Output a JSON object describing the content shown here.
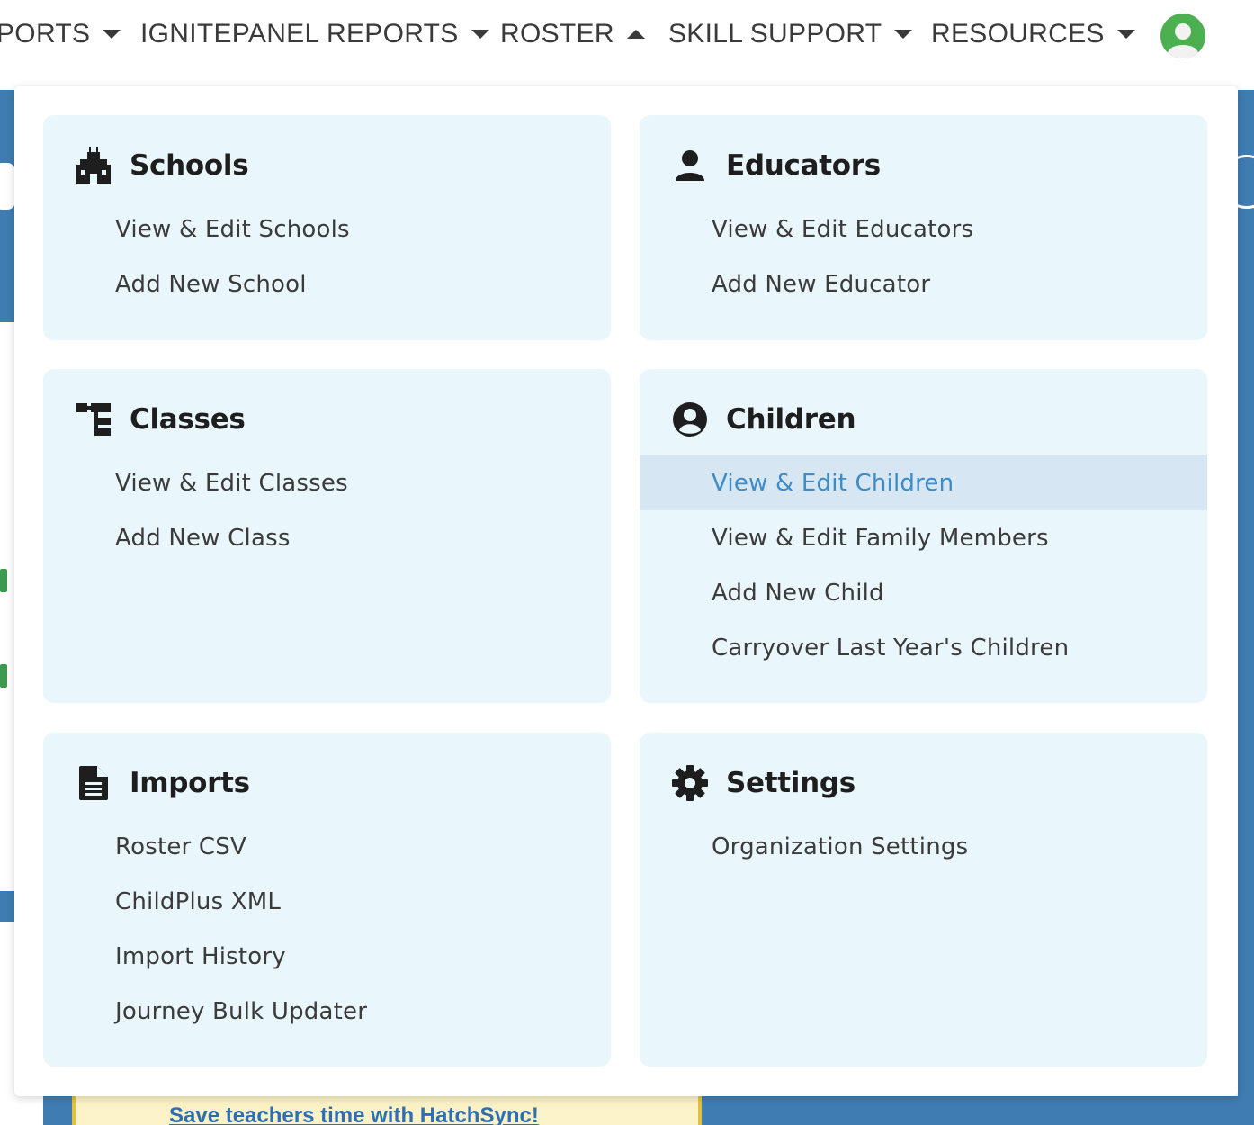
{
  "nav": {
    "items": [
      {
        "label": "PORTS",
        "caret": "down"
      },
      {
        "label": "IGNITEPANEL REPORTS",
        "caret": "down"
      },
      {
        "label": "ROSTER",
        "caret": "up"
      },
      {
        "label": "SKILL SUPPORT",
        "caret": "down"
      },
      {
        "label": "RESOURCES",
        "caret": "down"
      }
    ],
    "avatar_icon": "user-avatar-icon"
  },
  "dropdown": {
    "schools": {
      "title": "Schools",
      "icon": "school-building-icon",
      "links": [
        "View & Edit Schools",
        "Add New School"
      ]
    },
    "educators": {
      "title": "Educators",
      "icon": "person-icon",
      "links": [
        "View & Edit Educators",
        "Add New Educator"
      ]
    },
    "classes": {
      "title": "Classes",
      "icon": "hierarchy-icon",
      "links": [
        "View & Edit Classes",
        "Add New Class"
      ]
    },
    "children": {
      "title": "Children",
      "icon": "user-circle-icon",
      "links": [
        "View & Edit Children",
        "View & Edit Family Members",
        "Add New Child",
        "Carryover Last Year's Children"
      ],
      "active_link": "View & Edit Children"
    },
    "imports": {
      "title": "Imports",
      "icon": "document-icon",
      "links": [
        "Roster CSV",
        "ChildPlus XML",
        "Import History",
        "Journey Bulk Updater"
      ]
    },
    "settings": {
      "title": "Settings",
      "icon": "gear-icon",
      "links": [
        "Organization Settings"
      ]
    }
  },
  "background": {
    "banner_text": "Save teachers time with HatchSync!"
  },
  "colors": {
    "panel_bg": "#e9f6fb",
    "active_bg": "#d6e7f3",
    "active_text": "#3d8bc7",
    "page_blue": "#3f7cb2",
    "avatar_green": "#4caf50"
  }
}
